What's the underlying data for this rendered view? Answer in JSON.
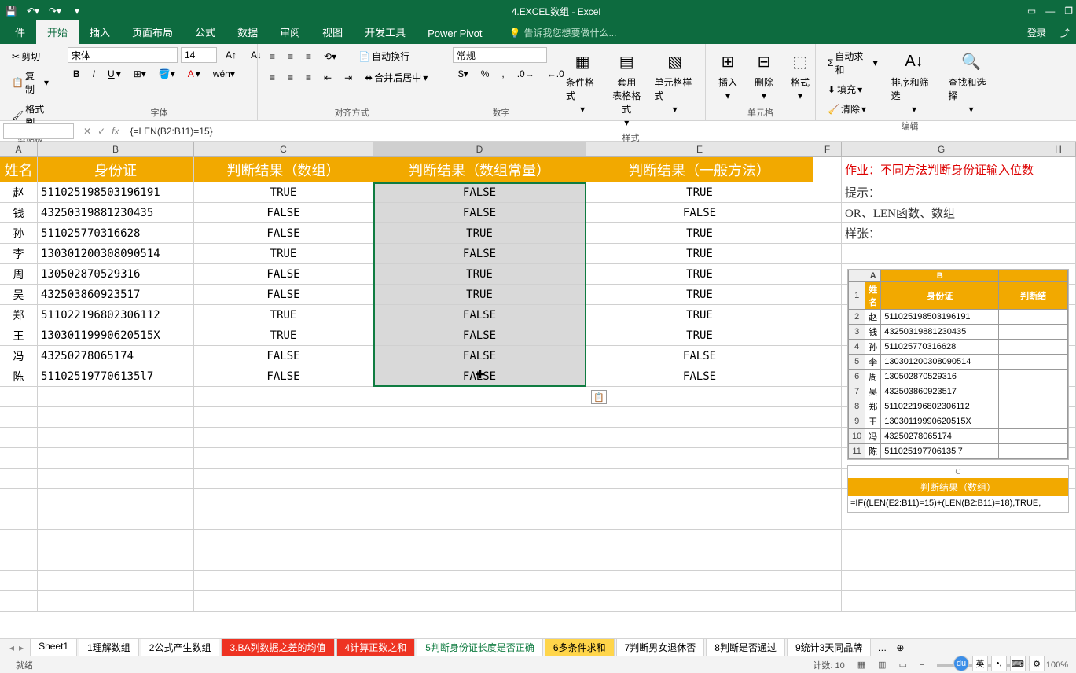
{
  "title": "4.EXCEL数组 - Excel",
  "signin": "登录",
  "tell_me": "告诉我您想要做什么...",
  "ribbon_tabs": [
    "件",
    "开始",
    "插入",
    "页面布局",
    "公式",
    "数据",
    "审阅",
    "视图",
    "开发工具",
    "Power Pivot"
  ],
  "active_tab": 1,
  "clipboard": {
    "cut": "剪切",
    "copy": "复制",
    "format": "格式刷",
    "label": "剪贴板"
  },
  "font": {
    "name": "宋体",
    "size": "14",
    "label": "字体"
  },
  "align": {
    "wrap": "自动换行",
    "merge": "合并后居中",
    "label": "对齐方式"
  },
  "number": {
    "format": "常规",
    "label": "数字"
  },
  "styles": {
    "cond": "条件格式",
    "table": "套用\n表格格式",
    "cell": "单元格样式",
    "label": "样式"
  },
  "cells": {
    "insert": "插入",
    "delete": "删除",
    "format": "格式",
    "label": "单元格"
  },
  "editing": {
    "sum": "自动求和",
    "fill": "填充",
    "clear": "清除",
    "sort": "排序和筛选",
    "find": "查找和选择",
    "label": "编辑"
  },
  "name_box": "",
  "formula": "{=LEN(B2:B11)=15}",
  "columns": [
    "A",
    "B",
    "C",
    "D",
    "E",
    "F",
    "G",
    "H"
  ],
  "headers": [
    "姓名",
    "身份证",
    "判断结果（数组）",
    "判断结果（数组常量）",
    "判断结果（一般方法）"
  ],
  "rows": [
    {
      "a": "赵",
      "b": "511025198503196191",
      "c": "TRUE",
      "d": "FALSE",
      "e": "TRUE"
    },
    {
      "a": "钱",
      "b": "43250319881230435",
      "c": "FALSE",
      "d": "FALSE",
      "e": "FALSE"
    },
    {
      "a": "孙",
      "b": "511025770316628",
      "c": "FALSE",
      "d": "TRUE",
      "e": "TRUE"
    },
    {
      "a": "李",
      "b": "130301200308090514",
      "c": "TRUE",
      "d": "FALSE",
      "e": "TRUE"
    },
    {
      "a": "周",
      "b": "130502870529316",
      "c": "FALSE",
      "d": "TRUE",
      "e": "TRUE"
    },
    {
      "a": "吴",
      "b": "432503860923517",
      "c": "FALSE",
      "d": "TRUE",
      "e": "TRUE"
    },
    {
      "a": "郑",
      "b": "511022196802306112",
      "c": "TRUE",
      "d": "FALSE",
      "e": "TRUE"
    },
    {
      "a": "王",
      "b": "13030119990620515X",
      "c": "TRUE",
      "d": "FALSE",
      "e": "TRUE"
    },
    {
      "a": "冯",
      "b": "43250278065174",
      "c": "FALSE",
      "d": "FALSE",
      "e": "FALSE"
    },
    {
      "a": "陈",
      "b": "511025197706135l7",
      "c": "FALSE",
      "d": "FALSE",
      "e": "FALSE"
    }
  ],
  "notes": {
    "hw": "作业：不同方法判断身份证输入位数",
    "hint": "提示：",
    "funcs": "OR、LEN函数、数组",
    "sample": "样张："
  },
  "mini_headers": [
    "姓名",
    "身份证",
    "判断结"
  ],
  "mini_rows": [
    [
      "赵",
      "511025198503196191"
    ],
    [
      "钱",
      "43250319881230435"
    ],
    [
      "孙",
      "511025770316628"
    ],
    [
      "李",
      "130301200308090514"
    ],
    [
      "周",
      "130502870529316"
    ],
    [
      "吴",
      "432503860923517"
    ],
    [
      "郑",
      "511022196802306112"
    ],
    [
      "王",
      "13030119990620515X"
    ],
    [
      "冯",
      "43250278065174"
    ],
    [
      "陈",
      "511025197706135l7"
    ]
  ],
  "mini2_header": "判断结果（数组）",
  "mini2_formula": "=IF((LEN(E2:B11)=15)+(LEN(B2:B11)=18),TRUE,",
  "sheet_tabs": [
    {
      "label": "Sheet1",
      "cls": ""
    },
    {
      "label": "1理解数组",
      "cls": ""
    },
    {
      "label": "2公式产生数组",
      "cls": ""
    },
    {
      "label": "3.BA列数据之差的均值",
      "cls": "red"
    },
    {
      "label": "4计算正数之和",
      "cls": "red"
    },
    {
      "label": "5判断身份证长度是否正确",
      "cls": "green"
    },
    {
      "label": "6多条件求和",
      "cls": "yellow"
    },
    {
      "label": "7判断男女退休否",
      "cls": ""
    },
    {
      "label": "8判断是否通过",
      "cls": ""
    },
    {
      "label": "9统计3天同品牌",
      "cls": ""
    }
  ],
  "status": {
    "ready": "就绪",
    "count": "计数: 10",
    "zoom": "100%"
  }
}
